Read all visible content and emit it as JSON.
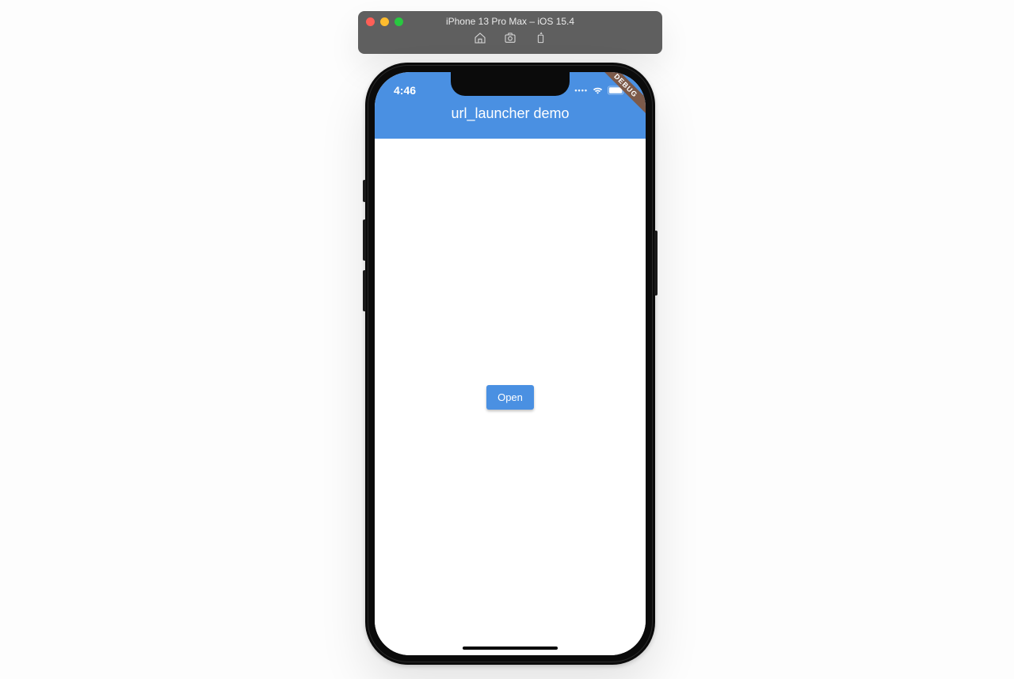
{
  "simulator": {
    "title": "iPhone 13 Pro Max – iOS 15.4"
  },
  "status": {
    "time": "4:46"
  },
  "app": {
    "title": "url_launcher demo",
    "debug_label": "DEBUG",
    "open_button": "Open"
  }
}
